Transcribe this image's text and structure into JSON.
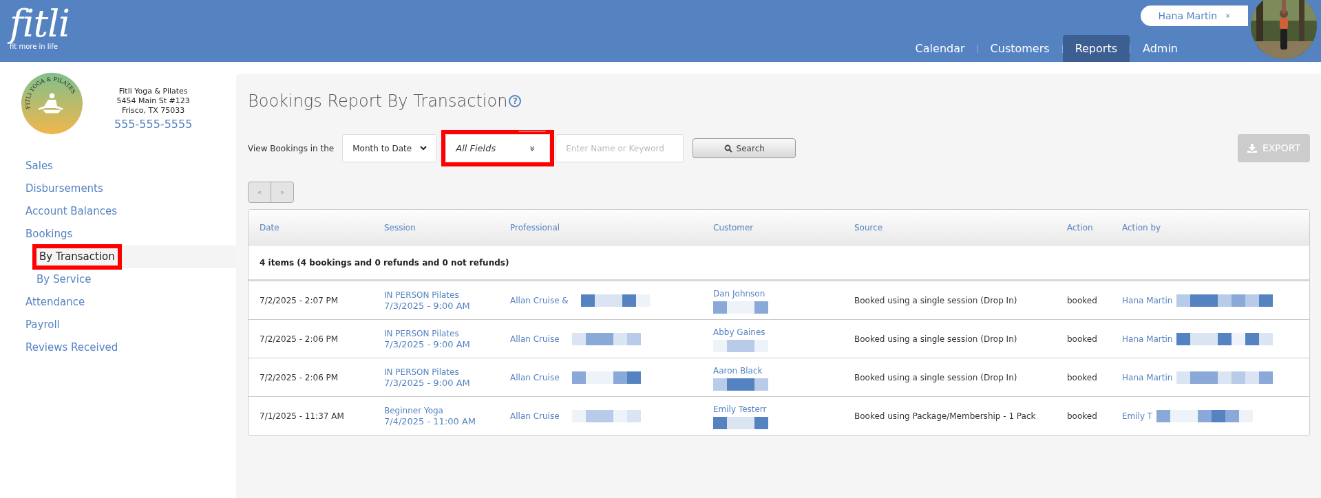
{
  "header": {
    "logo": "fitli",
    "tagline": "fit more in life",
    "user_menu": {
      "name": "Hana Martin",
      "icon": "»"
    },
    "nav": [
      {
        "label": "Calendar",
        "selected": false
      },
      {
        "label": "Customers",
        "selected": false
      },
      {
        "label": "Reports",
        "selected": true
      },
      {
        "label": "Admin",
        "selected": false
      }
    ]
  },
  "sidebar": {
    "studio": {
      "logo_text": "FITLI YOGA & PILATES",
      "name": "Fitli Yoga & Pilates",
      "address_1": "5454 Main St #123",
      "address_2": "Frisco, TX 75033",
      "phone": "555-555-5555"
    },
    "items": [
      {
        "label": "Sales",
        "selected": false,
        "highlighted": false
      },
      {
        "label": "Disbursements",
        "selected": false,
        "highlighted": false
      },
      {
        "label": "Account Balances",
        "selected": false,
        "highlighted": false
      },
      {
        "label": "Bookings",
        "selected": false,
        "highlighted": false,
        "children": [
          {
            "label": "By Transaction",
            "selected": true,
            "highlighted": true
          },
          {
            "label": "By Service",
            "selected": false,
            "highlighted": false
          }
        ]
      },
      {
        "label": "Attendance",
        "selected": false,
        "highlighted": false
      },
      {
        "label": "Payroll",
        "selected": false,
        "highlighted": false
      },
      {
        "label": "Reviews Received",
        "selected": false,
        "highlighted": false
      }
    ]
  },
  "report": {
    "title": "Bookings Report By Transaction",
    "help_icon": "?",
    "filters": {
      "label": "View Bookings in the",
      "period": "Month to Date",
      "field_select": {
        "value": "All Fields",
        "icon": "»",
        "highlighted": true
      },
      "search_placeholder": "Enter Name or Keyword",
      "search_button": "Search"
    },
    "export_button": {
      "label": "EXPORT",
      "disabled": true
    },
    "pager": {
      "prev": "«",
      "next": "»",
      "disabled": true
    },
    "table": {
      "columns": [
        "Date",
        "Session",
        "Professional",
        "Customer",
        "Source",
        "Action",
        "Action by"
      ],
      "summary": "4 items (4 bookings and 0 refunds and 0 not refunds)",
      "rows": [
        {
          "date": "7/2/2025 - 2:07 PM",
          "session": "IN PERSON Pilates",
          "session_time": "7/3/2025 - 9:00 AM",
          "professional": "Allan Cruise &",
          "customer": "Dan Johnson",
          "source": "Booked using a single session (Drop In)",
          "action": "booked",
          "action_by": "Hana Martin"
        },
        {
          "date": "7/2/2025 - 2:06 PM",
          "session": "IN PERSON Pilates",
          "session_time": "7/3/2025 - 9:00 AM",
          "professional": "Allan Cruise",
          "customer": "Abby Gaines",
          "source": "Booked using a single session (Drop In)",
          "action": "booked",
          "action_by": "Hana Martin"
        },
        {
          "date": "7/2/2025 - 2:06 PM",
          "session": "IN PERSON Pilates",
          "session_time": "7/3/2025 - 9:00 AM",
          "professional": "Allan Cruise",
          "customer": "Aaron Black",
          "source": "Booked using a single session (Drop In)",
          "action": "booked",
          "action_by": "Hana Martin"
        },
        {
          "date": "7/1/2025 - 11:37 AM",
          "session": "Beginner Yoga",
          "session_time": "7/4/2025 - 11:00 AM",
          "professional": "Allan Cruise",
          "customer": "Emily Testerr",
          "source": "Booked using Package/Membership - 1 Pack",
          "action": "booked",
          "action_by": "Emily T"
        }
      ]
    }
  }
}
